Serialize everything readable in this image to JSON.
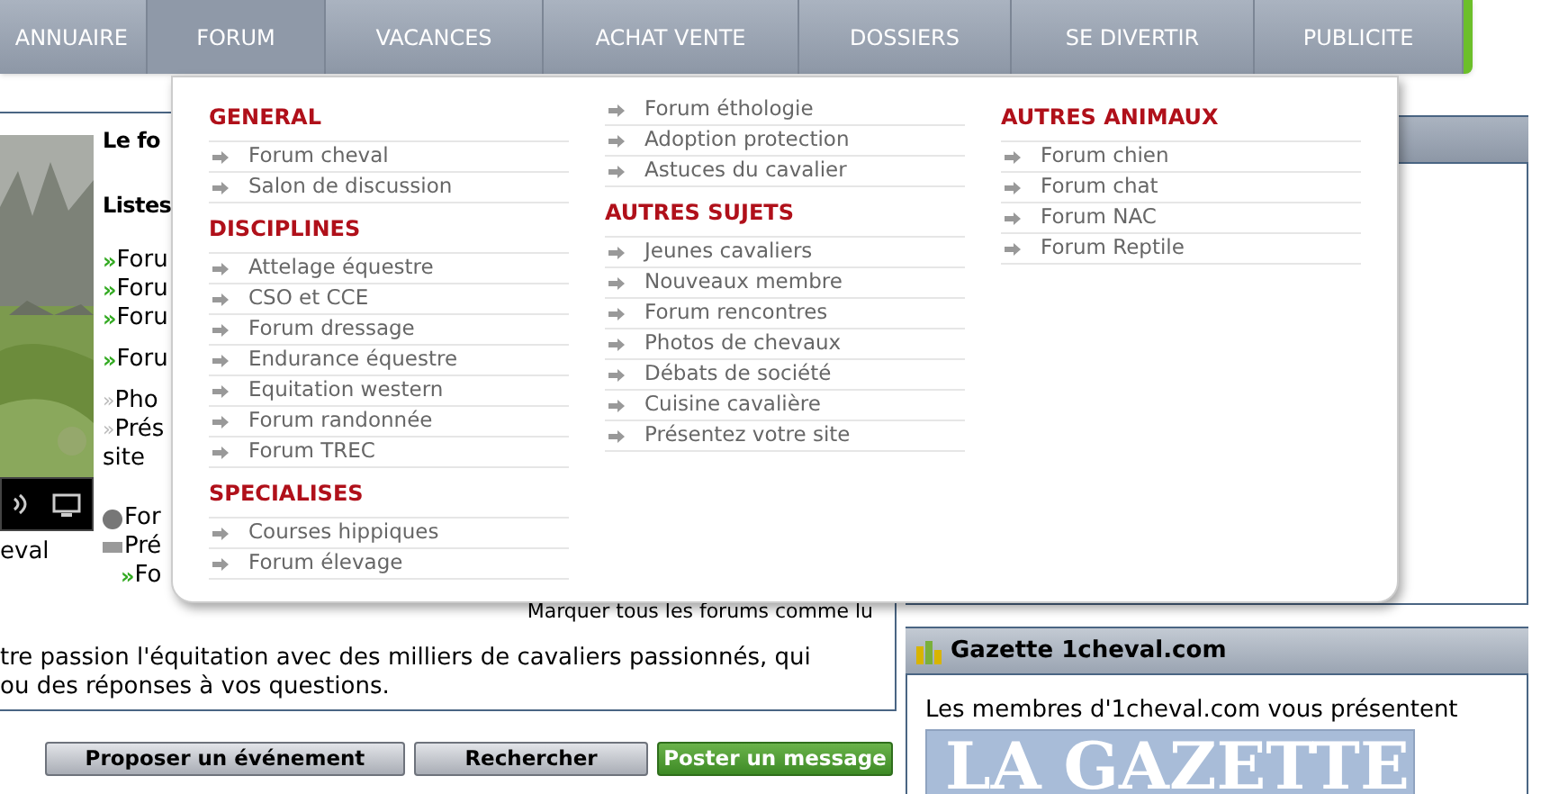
{
  "nav": [
    {
      "label": "ANNUAIRE",
      "selected": false
    },
    {
      "label": "FORUM",
      "selected": true
    },
    {
      "label": "VACANCES",
      "selected": false
    },
    {
      "label": "ACHAT VENTE",
      "selected": false
    },
    {
      "label": "DOSSIERS",
      "selected": false
    },
    {
      "label": "SE DIVERTIR",
      "selected": false
    },
    {
      "label": "PUBLICITE",
      "selected": false
    }
  ],
  "menu": {
    "columns": [
      {
        "sections": [
          {
            "heading": "GENERAL",
            "items": [
              "Forum cheval",
              "Salon de discussion"
            ]
          },
          {
            "heading": "DISCIPLINES",
            "items": [
              "Attelage équestre",
              "CSO et CCE",
              "Forum dressage",
              "Endurance équestre",
              "Equitation western",
              "Forum randonnée",
              "Forum TREC"
            ]
          },
          {
            "heading": "SPECIALISES",
            "items": [
              "Courses hippiques",
              "Forum élevage"
            ]
          }
        ]
      },
      {
        "sections": [
          {
            "items": [
              "Forum éthologie",
              "Adoption protection",
              "Astuces du cavalier"
            ]
          },
          {
            "heading": "AUTRES SUJETS",
            "items": [
              "Jeunes cavaliers",
              "Nouveaux membre",
              "Forum rencontres",
              "Photos de chevaux",
              "Débats de société",
              "Cuisine cavalière",
              "Présentez votre site"
            ]
          }
        ]
      },
      {
        "sections": [
          {
            "heading": "AUTRES ANIMAUX",
            "items": [
              "Forum chien",
              "Forum chat",
              "Forum NAC",
              "Forum Reptile"
            ]
          }
        ]
      }
    ]
  },
  "video": {
    "caption": "eval"
  },
  "intro": {
    "title": "Le fo",
    "subtitle": "Listes",
    "lines": [
      {
        "kind": "green",
        "marker": "»",
        "text": "Foru"
      },
      {
        "kind": "green",
        "marker": "»",
        "text": "Foru"
      },
      {
        "kind": "green",
        "marker": "»",
        "text": "Foru"
      },
      {
        "kind": "green",
        "marker": "»",
        "text": "Foru"
      },
      {
        "kind": "grey",
        "marker": "»",
        "text": "Pho"
      },
      {
        "kind": "grey",
        "marker": "»",
        "text": "Prés"
      },
      {
        "kind": "plain",
        "text": "site"
      },
      {
        "kind": "cake",
        "text": "For"
      },
      {
        "kind": "new",
        "text": "Pré"
      },
      {
        "kind": "dash",
        "marker": "»",
        "text": "Fo"
      }
    ]
  },
  "mark_read": "Marquer tous les forums comme lu",
  "description": [
    "tre passion l'équitation avec des milliers de cavaliers passionnés, qui",
    "ou des réponses à vos questions."
  ],
  "buttons": [
    {
      "kind": "grey",
      "label": "Proposer un événement"
    },
    {
      "kind": "grey",
      "label": "Rechercher"
    },
    {
      "kind": "green",
      "label": "Poster un message"
    }
  ],
  "gazette": {
    "title": "Gazette 1cheval.com",
    "text": "Les membres d'1cheval.com vous présentent",
    "banner": "LA GAZETTE"
  }
}
